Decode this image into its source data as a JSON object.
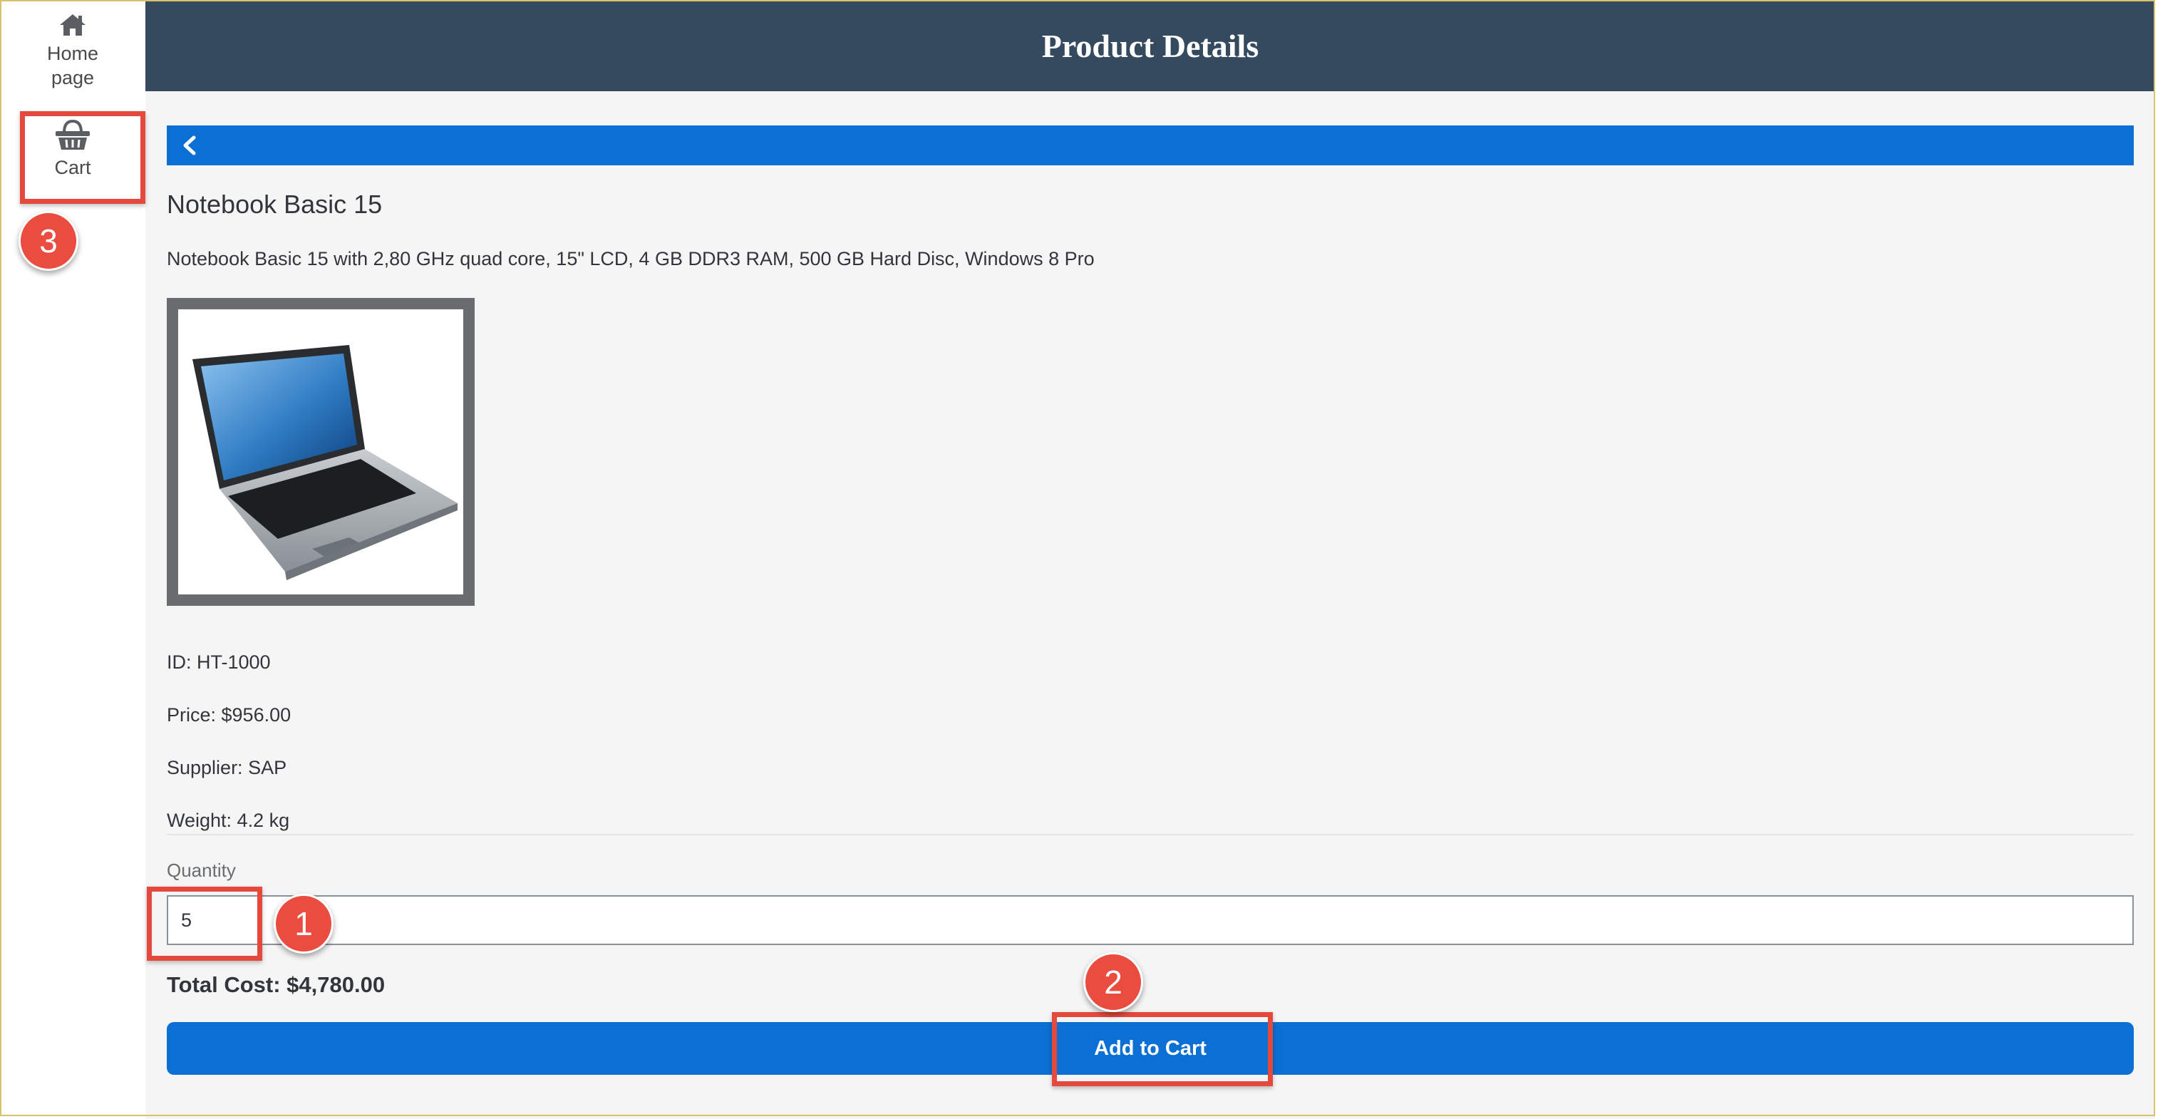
{
  "sidebar": {
    "items": [
      {
        "label": "Home\npage",
        "icon": "home-icon"
      },
      {
        "label": "Cart",
        "icon": "basket-icon"
      }
    ]
  },
  "header": {
    "title": "Product Details"
  },
  "product": {
    "name": "Notebook Basic 15",
    "description": "Notebook Basic 15 with 2,80 GHz quad core, 15\" LCD, 4 GB DDR3 RAM, 500 GB Hard Disc, Windows 8 Pro",
    "image": "laptop-image",
    "id": "ID: HT-1000",
    "price": "Price: $956.00",
    "supplier": "Supplier: SAP",
    "weight": "Weight: 4.2 kg"
  },
  "quantity": {
    "label": "Quantity",
    "value": "5"
  },
  "total": "Total Cost: $4,780.00",
  "add_button": "Add to Cart",
  "annotations": {
    "step1": "1",
    "step2": "2",
    "step3": "3"
  },
  "colors": {
    "header_bg": "#354a5f",
    "accent": "#0b6fd3",
    "annotation": "#e5483d"
  }
}
